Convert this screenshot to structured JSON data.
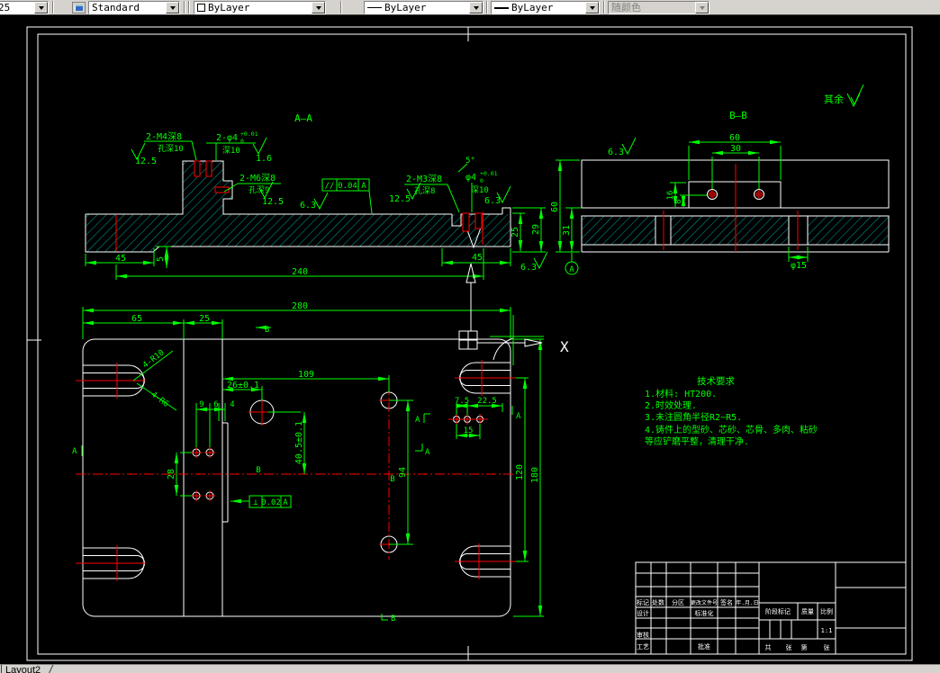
{
  "toolbar": {
    "layer_value": "25",
    "style_value": "Standard",
    "color_value": "ByLayer",
    "linetype_value": "ByLayer",
    "lineweight_value": "ByLayer",
    "plotstyle_value": "随颜色"
  },
  "tab": {
    "layout2": "Layout2"
  },
  "colors": {
    "dimension_green": "#00ff00",
    "object_white": "#ffffff",
    "centerline_red": "#ff0000",
    "hatch_cyan": "#00d0d0",
    "canvas_black": "#000000",
    "ui_gray": "#d6d3ce"
  },
  "aa": {
    "label": "A—A",
    "note_m4": "2-M4深8",
    "note_m4_sub": "孔深10",
    "rough_m4": "12.5",
    "note_phi4": "2-φ4",
    "tol_sup": "+0.01",
    "tol_sub": "0",
    "note_phi4_sub": "深10",
    "rough_phi4": "1.6",
    "note_m6": "2-M6深8",
    "note_m6_sub": "孔深9",
    "rough_m6": "12.5",
    "fcf_sym": "//",
    "fcf_val": "0.04",
    "fcf_ref": "A",
    "rough_63a": "6.3",
    "rough_125c": "12.5",
    "note_m3": "2-M3深8",
    "note_m3_sub": "孔深8",
    "note_phi4b": "φ4",
    "note_phi4b_sub": "深10",
    "rough_63c": "6.3",
    "angle": "5°",
    "dim_45l": "45",
    "dim_5": "5",
    "dim_240": "240",
    "dim_45r": "45",
    "dim_25": "25",
    "dim_29": "29",
    "rough_63b": "6.3"
  },
  "bb": {
    "label": "B—B",
    "rough": "6.3",
    "dim_60t": "60",
    "dim_30": "30",
    "dim_16": "16",
    "dim_8": "8",
    "dim_60l": "60",
    "dim_31": "31",
    "dim_phi15": "φ15",
    "datum": "A"
  },
  "plan": {
    "dim_280": "280",
    "dim_65": "65",
    "dim_25": "25",
    "dim_109": "109",
    "dim_26": "26±0.1",
    "dim_9": "9",
    "dim_6": "6",
    "dim_4": "4",
    "dim_405": "40.5±0.1",
    "dim_28": "28",
    "dim_94": "94",
    "dim_75": "7.5",
    "dim_225": "22.5",
    "dim_15": "15",
    "dim_120": "120",
    "dim_180": "180",
    "note_r10": "4-R10",
    "note_r6": "4-R6",
    "fcf_sym": "⊥",
    "fcf_val": "0.02",
    "fcf_ref": "A",
    "sec_a": "A",
    "sec_b": "B"
  },
  "misc": {
    "rest_label": "其余",
    "axis_x": "X"
  },
  "tech": {
    "title": "技术要求",
    "line1": "1.材料: HT200.",
    "line2": "2.时效处理.",
    "line3": "3.未注圆角半径R2~R5.",
    "line4": "4.铸件上的型砂、芯砂、芯骨、多肉、粘砂",
    "line5": "等应铲磨平整，清理干净."
  },
  "titleblock": {
    "mark": "标记",
    "count": "处数",
    "zone": "分区",
    "change_file": "更改文件号",
    "sign": "签名",
    "date": "年.月.日",
    "design": "设计",
    "standardization": "标准化",
    "stage": "阶段标记",
    "weight": "质量",
    "scale_label": "比例",
    "check": "审核",
    "process": "工艺",
    "approve": "批准",
    "scale": "1:1",
    "total": "共",
    "sheet1": "张",
    "no": "第",
    "sheet2": "张"
  }
}
